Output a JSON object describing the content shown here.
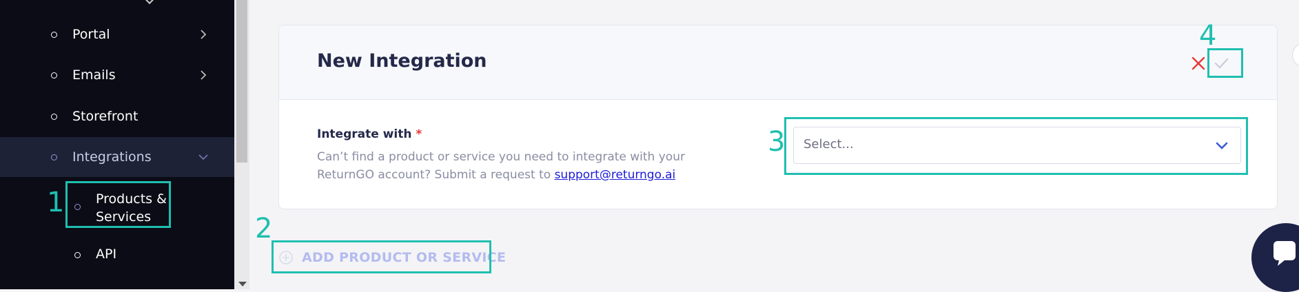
{
  "sidebar": {
    "items": [
      {
        "label": "Portal",
        "has_chevron": true
      },
      {
        "label": "Emails",
        "has_chevron": true
      },
      {
        "label": "Storefront",
        "has_chevron": false
      },
      {
        "label": "Integrations",
        "has_chevron": true,
        "active": true
      }
    ],
    "sub_items": [
      {
        "label_line1": "Products &",
        "label_line2": "Services"
      },
      {
        "label": "API"
      }
    ]
  },
  "card": {
    "title": "New Integration",
    "close_icon": "x-icon",
    "confirm_icon": "checkmark-icon",
    "field_label": "Integrate with",
    "required_mark": "*",
    "help_text": "Can’t find a product or service you need to integrate with your ReturnGO account? Submit a request to",
    "help_link": "support@returngo.ai",
    "select_placeholder": "Select..."
  },
  "add_button": {
    "label": "ADD PRODUCT OR SERVICE",
    "icon": "plus-circle-icon"
  },
  "annotations": [
    "1",
    "2",
    "3",
    "4"
  ],
  "colors": {
    "sidebar_bg": "#0c0c16",
    "sidebar_active_bg": "#1e2236",
    "annotation": "#1fbfb0",
    "title": "#24294a",
    "close": "#e53935",
    "accent_chevron": "#3d5bd9",
    "add_button_text": "#b4bbef",
    "chat_button": "#1d2247"
  }
}
